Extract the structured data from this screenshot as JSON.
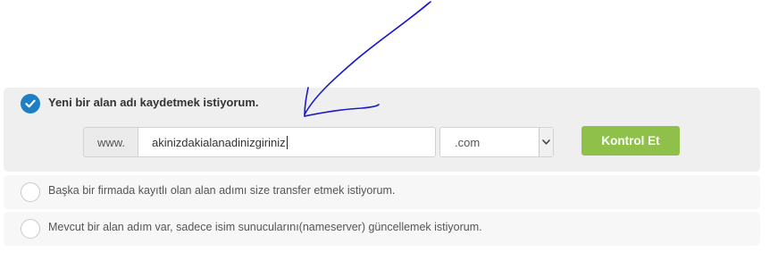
{
  "register": {
    "label": "Yeni bir alan adı kaydetmek istiyorum.",
    "selected": true,
    "www_prefix": "www.",
    "domain_value": "akinizdakialanadinizgiriniz",
    "tld_selected": ".com",
    "check_button_label": "Kontrol Et"
  },
  "transfer": {
    "label": "Başka bir firmada kayıtlı olan alan adımı size transfer etmek istiyorum.",
    "selected": false
  },
  "nameserver": {
    "label": "Mevcut bir alan adım var, sadece isim sunucularını(nameserver) güncellemek istiyorum.",
    "selected": false
  },
  "colors": {
    "accent_blue": "#1f7fc4",
    "button_green": "#8fc14a",
    "annotation_ink": "#1a1acc"
  },
  "annotation": {
    "icon": "hand-drawn-arrow-icon"
  }
}
